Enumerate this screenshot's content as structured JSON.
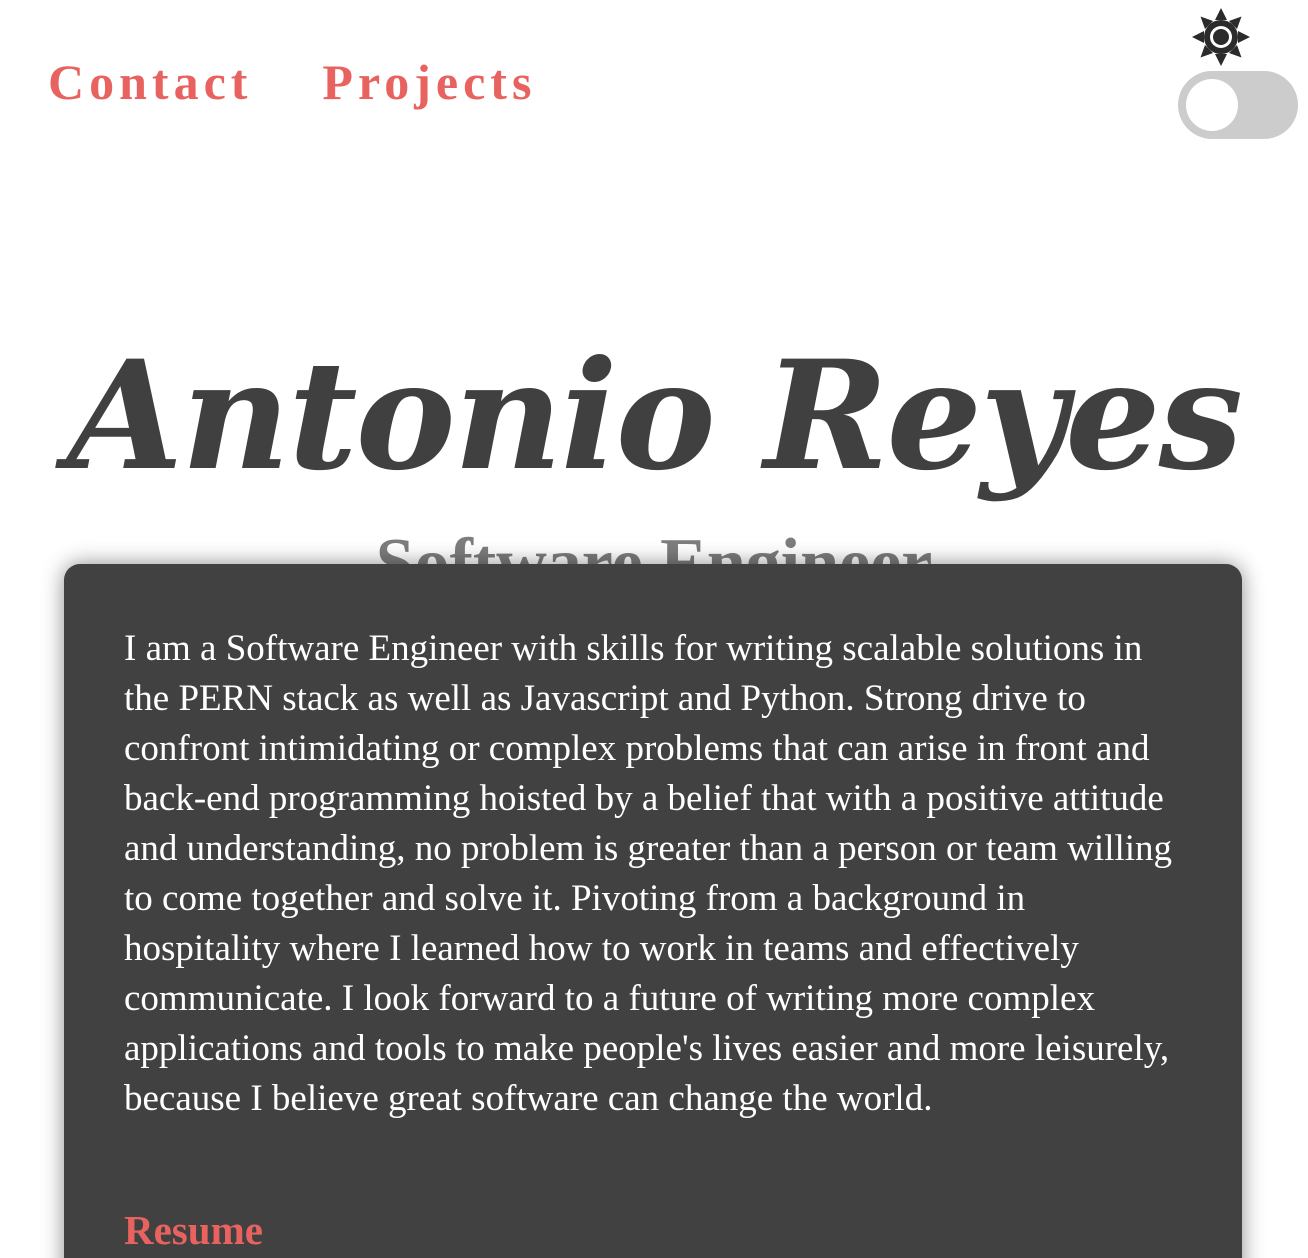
{
  "nav": {
    "contact_label": "Contact",
    "projects_label": "Projects"
  },
  "theme": {
    "icon": "sun-icon",
    "toggle_on": false
  },
  "header": {
    "name": "Antonio Reyes",
    "title": "Software Engineer"
  },
  "about": {
    "bio": "I am a Software Engineer with skills for writing scalable solutions in the PERN stack as well as Javascript and Python. Strong drive to confront intimidating or complex problems that can arise in front and back-end programming hoisted by a belief that with a positive attitude and understanding, no problem is greater than a person or team willing to come together and solve it. Pivoting from a background in hospitality where I learned how to work in teams and effectively communicate. I look forward to a future of writing more complex applications and tools to make people's lives easier and more leisurely, because I believe great software can change the world.",
    "resume_label": "Resume"
  },
  "colors": {
    "accent": "#e8635f",
    "card_background": "#414141",
    "name_text": "#404040",
    "subtitle_text": "#7d7d7d",
    "toggle_track": "#cccccc"
  }
}
